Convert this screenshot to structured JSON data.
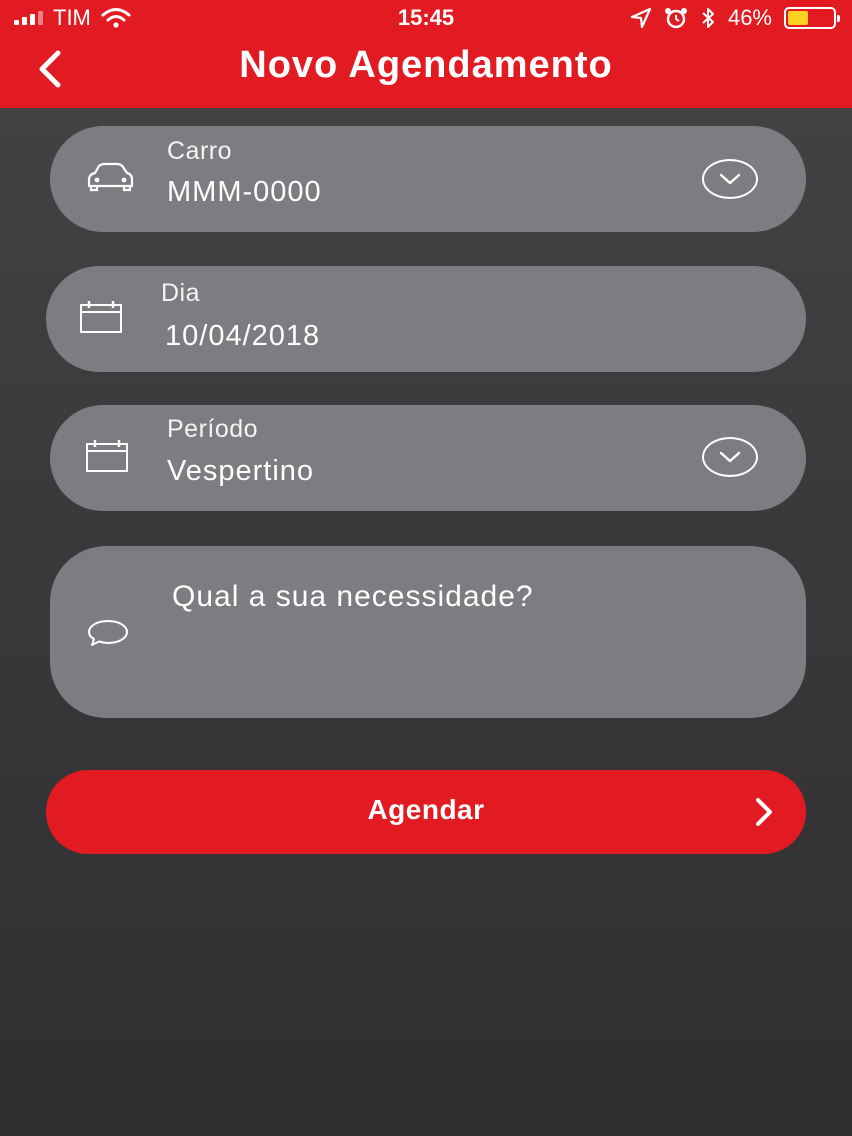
{
  "status_bar": {
    "carrier": "TIM",
    "time": "15:45",
    "battery_text": "46%",
    "battery_level": 0.46,
    "battery_color": "#ffd21f"
  },
  "header": {
    "title": "Novo Agendamento",
    "back_icon": "chevron-left-icon",
    "color": "#e21b23"
  },
  "form": {
    "car": {
      "label": "Carro",
      "value": "MMM-0000",
      "icon": "car-icon"
    },
    "day": {
      "label": "Dia",
      "value": "10/04/2018",
      "icon": "calendar-icon"
    },
    "period": {
      "label": "Período",
      "value": "Vespertino",
      "icon": "calendar-icon"
    },
    "need": {
      "placeholder": "Qual a sua necessidade?",
      "icon": "chat-bubble-icon"
    }
  },
  "submit": {
    "label": "Agendar",
    "icon": "chevron-right-icon"
  }
}
